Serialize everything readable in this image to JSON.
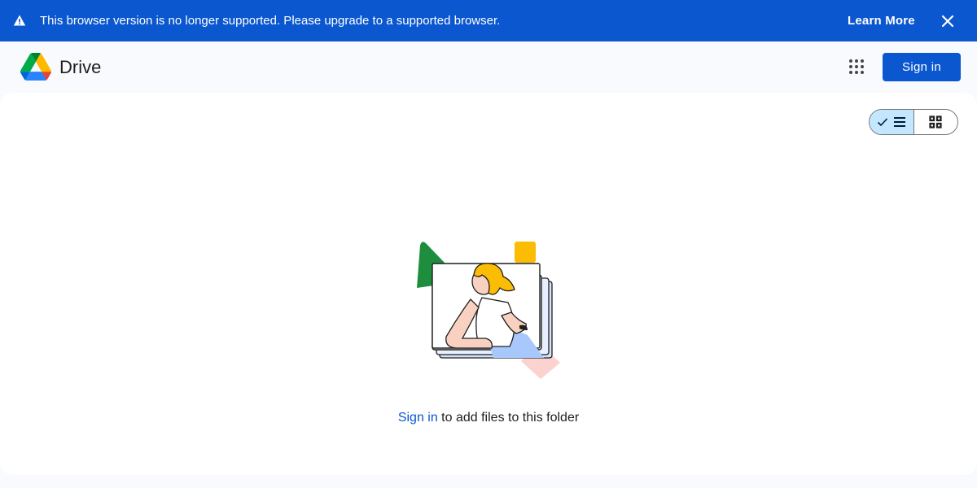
{
  "banner": {
    "message": "This browser version is no longer supported. Please upgrade to a supported browser.",
    "learn_more": "Learn More",
    "icons": {
      "warning": "warning-icon",
      "close": "close-icon"
    }
  },
  "header": {
    "product": "Drive",
    "sign_in": "Sign in",
    "icons": {
      "logo": "drive-logo",
      "apps": "apps-grid-icon"
    }
  },
  "main": {
    "view_toggle": {
      "list_selected": true,
      "icons": [
        "check-icon",
        "list-view-icon",
        "grid-view-icon"
      ]
    },
    "empty_state": {
      "link": "Sign in",
      "text": " to add files to this folder"
    }
  },
  "colors": {
    "banner": "#0b57d0",
    "accent": "#0b57d0",
    "toggle_selected": "#c2e7ff",
    "page_bg": "#f8fafd"
  }
}
